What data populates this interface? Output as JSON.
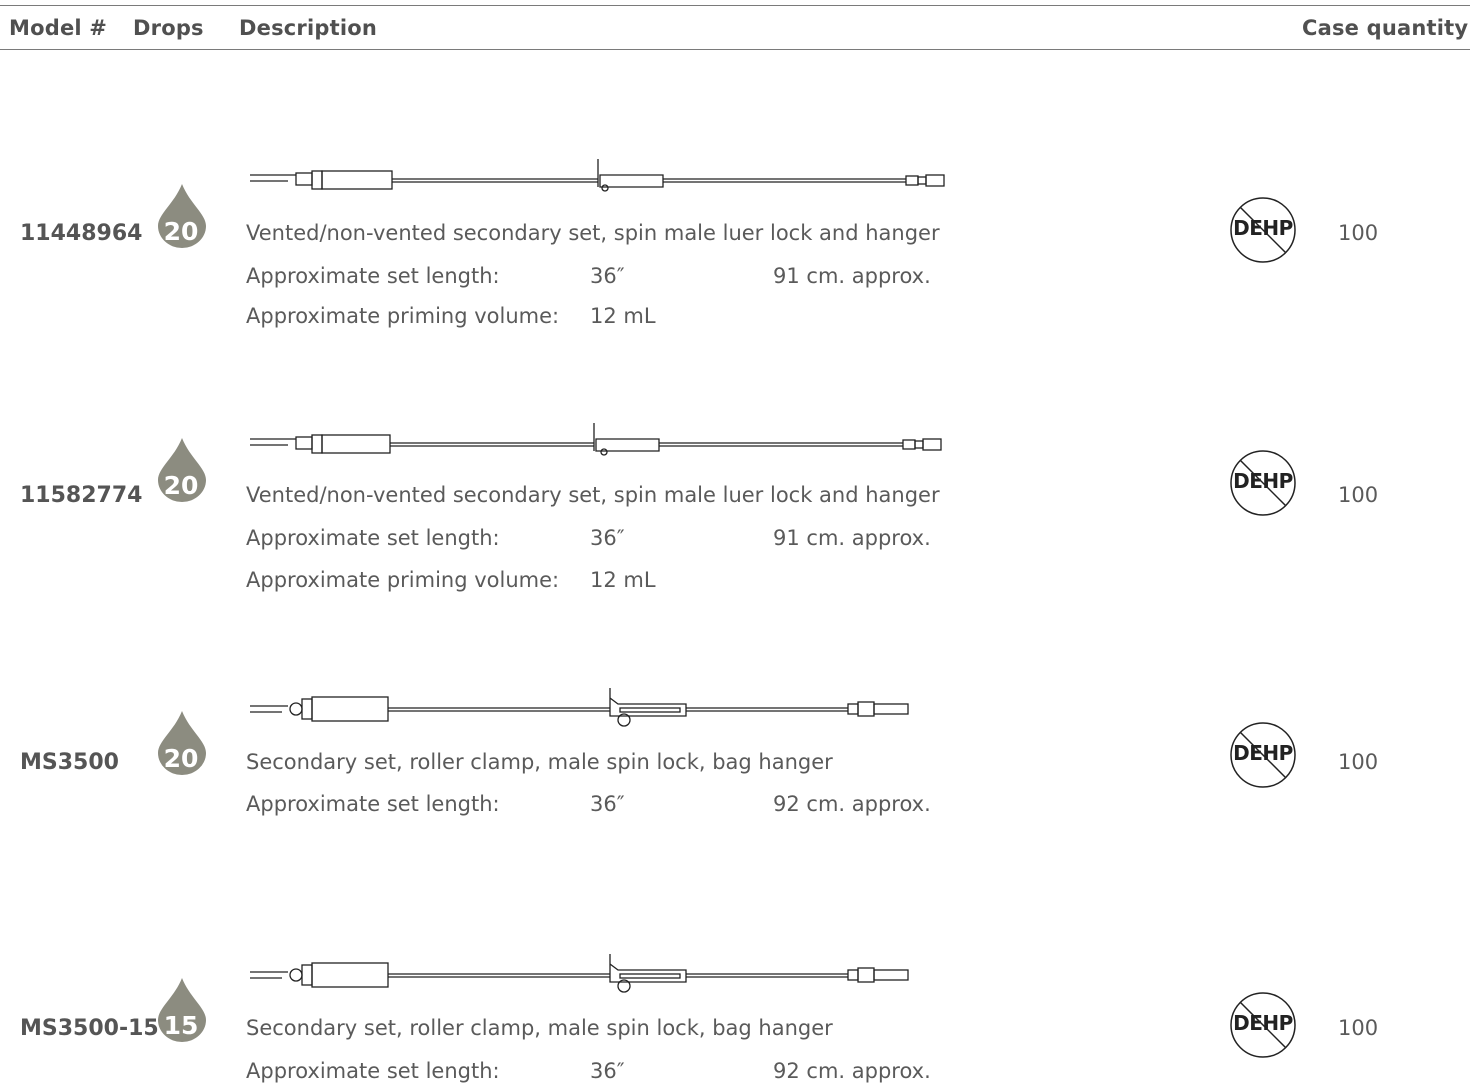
{
  "header": {
    "model_label": "Model #",
    "drops_label": "Drops",
    "description_label": "Description",
    "case_quantity_label": "Case quantity"
  },
  "products": [
    {
      "model": "11448964",
      "drops": "20",
      "description": "Vented/non-vented secondary set, spin male luer lock and hanger",
      "set_length_label": "Approximate set length:",
      "set_length_in": "36″",
      "set_length_cm": "91 cm. approx.",
      "priming_label": "Approximate priming volume:",
      "priming_value": "12 mL",
      "dehp_label": "DEHP",
      "case_quantity": "100"
    },
    {
      "model": "11582774",
      "drops": "20",
      "description": "Vented/non-vented secondary set, spin male luer lock and hanger",
      "set_length_label": "Approximate set length:",
      "set_length_in": "36″",
      "set_length_cm": "91 cm. approx.",
      "priming_label": "Approximate priming volume:",
      "priming_value": "12 mL",
      "dehp_label": "DEHP",
      "case_quantity": "100"
    },
    {
      "model": "MS3500",
      "drops": "20",
      "description": "Secondary set, roller clamp, male spin lock, bag hanger",
      "set_length_label": "Approximate set length:",
      "set_length_in": "36″",
      "set_length_cm": "92 cm. approx.",
      "dehp_label": "DEHP",
      "case_quantity": "100"
    },
    {
      "model": "MS3500-15",
      "drops": "15",
      "description": "Secondary set, roller clamp, male spin lock, bag hanger",
      "set_length_label": "Approximate set length:",
      "set_length_in": "36″",
      "set_length_cm": "92 cm. approx.",
      "dehp_label": "DEHP",
      "case_quantity": "100"
    }
  ],
  "colors": {
    "drop_fill": "#8c8c80",
    "drop_highlight": "#a9a99e",
    "rule": "#7a7a7a"
  },
  "icons": {
    "drop": "drop-icon",
    "dehp": "no-dehp-icon"
  }
}
